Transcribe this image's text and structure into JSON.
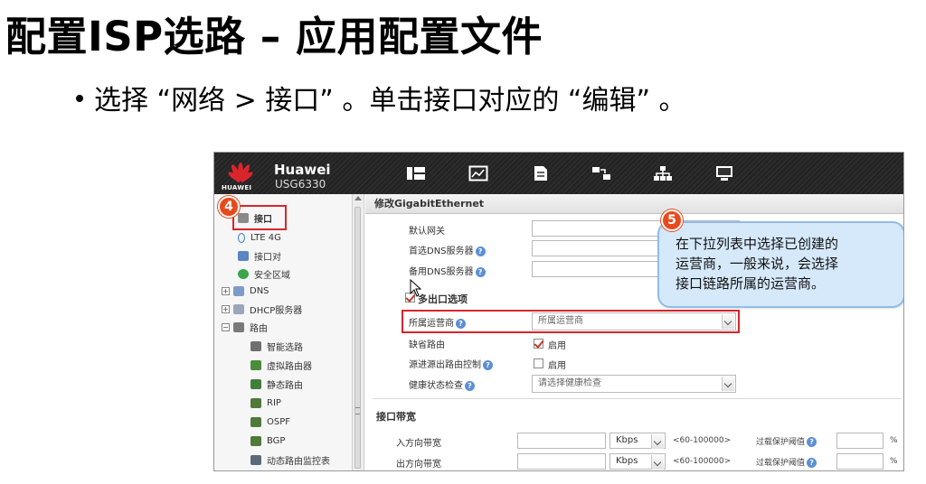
{
  "slide": {
    "title": "配置ISP选路 – 应用配置文件",
    "bullet": "选择 “网络 > 接口” 。单击接口对应的 “编辑” 。"
  },
  "header": {
    "logo_text": "HUAWEI",
    "brand": "Huawei",
    "model": "USG6330",
    "nav_icons": [
      "dashboard-icon",
      "monitor-icon",
      "policy-icon",
      "objects-icon",
      "network-icon",
      "system-icon"
    ]
  },
  "sidebar": {
    "items": [
      {
        "label": "接口"
      },
      {
        "label": "LTE 4G"
      },
      {
        "label": "接口对"
      },
      {
        "label": "安全区域"
      },
      {
        "label": "DNS"
      },
      {
        "label": "DHCP服务器"
      },
      {
        "label": "路由"
      },
      {
        "label": "智能选路"
      },
      {
        "label": "虚拟路由器"
      },
      {
        "label": "静态路由"
      },
      {
        "label": "RIP"
      },
      {
        "label": "OSPF"
      },
      {
        "label": "BGP"
      },
      {
        "label": "动态路由监控表"
      }
    ]
  },
  "steps": {
    "step4": "4",
    "step5": "5"
  },
  "panel": {
    "title": "修改GigabitEthernet",
    "fields": {
      "default_gateway": "默认网关",
      "primary_dns": "首选DNS服务器",
      "backup_dns": "备用DNS服务器",
      "multi_egress": "多出口选项",
      "isp_label": "所属运营商",
      "isp_placeholder": "所属运营商",
      "default_route": "缺省路由",
      "default_route_check": "启用",
      "source_route": "源进源出路由控制",
      "source_route_check": "启用",
      "health_check": "健康状态检查",
      "health_check_placeholder": "请选择健康检查"
    },
    "bandwidth": {
      "title": "接口带宽",
      "inbound": "入方向带宽",
      "outbound": "出方向带宽",
      "unit": "Kbps",
      "range": "<60-100000>",
      "protect_threshold": "过载保护阈值",
      "percent": "%"
    }
  },
  "callout": {
    "line1": "在下拉列表中选择已创建的",
    "line2": "运营商，一般来说，会选择",
    "line3": "接口链路所属的运营商。"
  }
}
